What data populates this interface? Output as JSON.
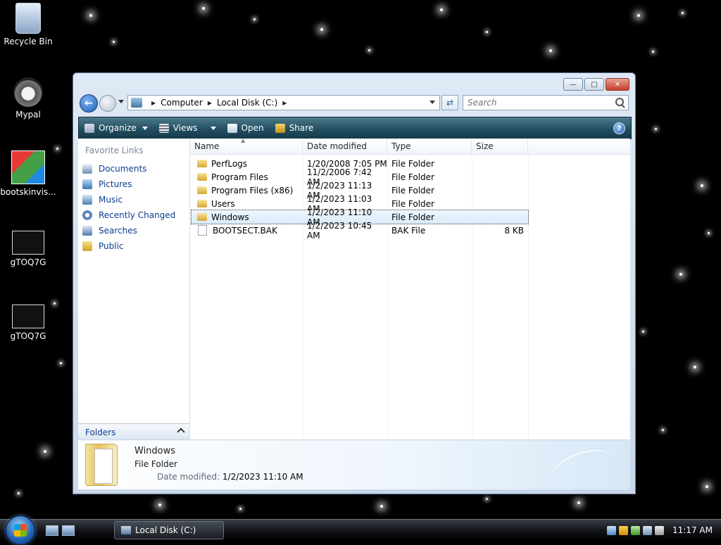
{
  "desktop": {
    "icons": [
      {
        "label": "Recycle Bin",
        "icon": "recycle-bin-icon"
      },
      {
        "label": "Mypal",
        "icon": "raccoon-app-icon"
      },
      {
        "label": "bootskinvis...",
        "icon": "installer-icon"
      },
      {
        "label": "gTOQ7G",
        "icon": "image-thumbnail-icon"
      },
      {
        "label": "gTOQ7G",
        "icon": "image-thumbnail-icon"
      }
    ]
  },
  "window": {
    "address": {
      "crumbs": [
        "Computer",
        "Local Disk (C:)"
      ]
    },
    "search": {
      "placeholder": "Search"
    },
    "toolbar": {
      "organize": "Organize",
      "views": "Views",
      "open": "Open",
      "share": "Share"
    },
    "nav": {
      "heading": "Favorite Links",
      "links": [
        "Documents",
        "Pictures",
        "Music",
        "Recently Changed",
        "Searches",
        "Public"
      ],
      "folders_label": "Folders"
    },
    "columns": {
      "name": "Name",
      "date": "Date modified",
      "type": "Type",
      "size": "Size"
    },
    "files": [
      {
        "name": "PerfLogs",
        "date": "1/20/2008 7:05 PM",
        "type": "File Folder",
        "size": "",
        "kind": "folder"
      },
      {
        "name": "Program Files",
        "date": "11/2/2006 7:42 AM",
        "type": "File Folder",
        "size": "",
        "kind": "folder"
      },
      {
        "name": "Program Files (x86)",
        "date": "1/2/2023 11:13 AM",
        "type": "File Folder",
        "size": "",
        "kind": "folder"
      },
      {
        "name": "Users",
        "date": "1/2/2023 11:03 AM",
        "type": "File Folder",
        "size": "",
        "kind": "folder"
      },
      {
        "name": "Windows",
        "date": "1/2/2023 11:10 AM",
        "type": "File Folder",
        "size": "",
        "kind": "folder",
        "selected": true
      },
      {
        "name": "BOOTSECT.BAK",
        "date": "1/2/2023 10:45 AM",
        "type": "BAK File",
        "size": "8 KB",
        "kind": "file"
      }
    ],
    "details": {
      "title": "Windows",
      "subtitle": "File Folder",
      "meta_key": "Date modified:",
      "meta_value": "1/2/2023 11:10 AM"
    }
  },
  "taskbar": {
    "task_label": "Local Disk (C:)",
    "clock": "11:17 AM"
  },
  "colors": {
    "link": "#0b3d91",
    "toolbar": "#1f4c5f",
    "selection": "#d9ebfa"
  }
}
